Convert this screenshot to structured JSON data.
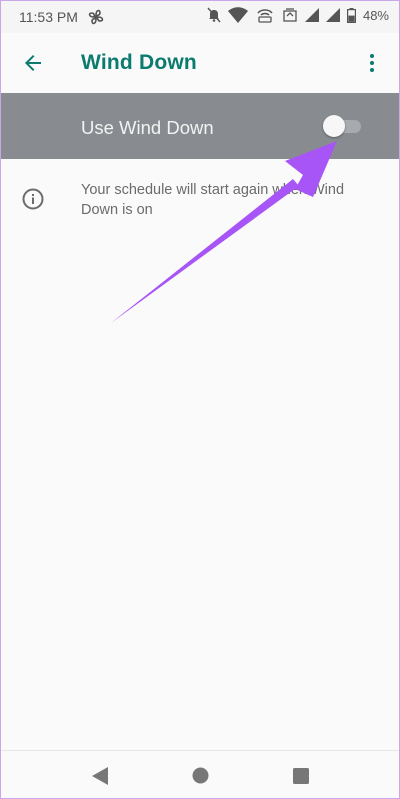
{
  "status_bar": {
    "time": "11:53 PM",
    "battery_percent": "48%",
    "icons": [
      "fan-icon",
      "mute-icon",
      "wifi-icon",
      "hotspot-icon",
      "data-saver-icon",
      "signal-icon",
      "signal-icon",
      "battery-icon"
    ]
  },
  "app_bar": {
    "title": "Wind Down",
    "back_icon": "arrow-left-icon",
    "menu_icon": "more-vertical-icon"
  },
  "toggle": {
    "label": "Use Wind Down",
    "state": "off"
  },
  "info": {
    "icon": "info-icon",
    "text": "Your schedule will start again when Wind Down is on"
  },
  "colors": {
    "accent": "#0b7a6f",
    "toggle_row_bg": "#888c90",
    "annotation_arrow": "#a855f7",
    "background": "#fafafa"
  },
  "nav_bar": {
    "icons": [
      "nav-back-icon",
      "nav-home-icon",
      "nav-recents-icon"
    ]
  }
}
